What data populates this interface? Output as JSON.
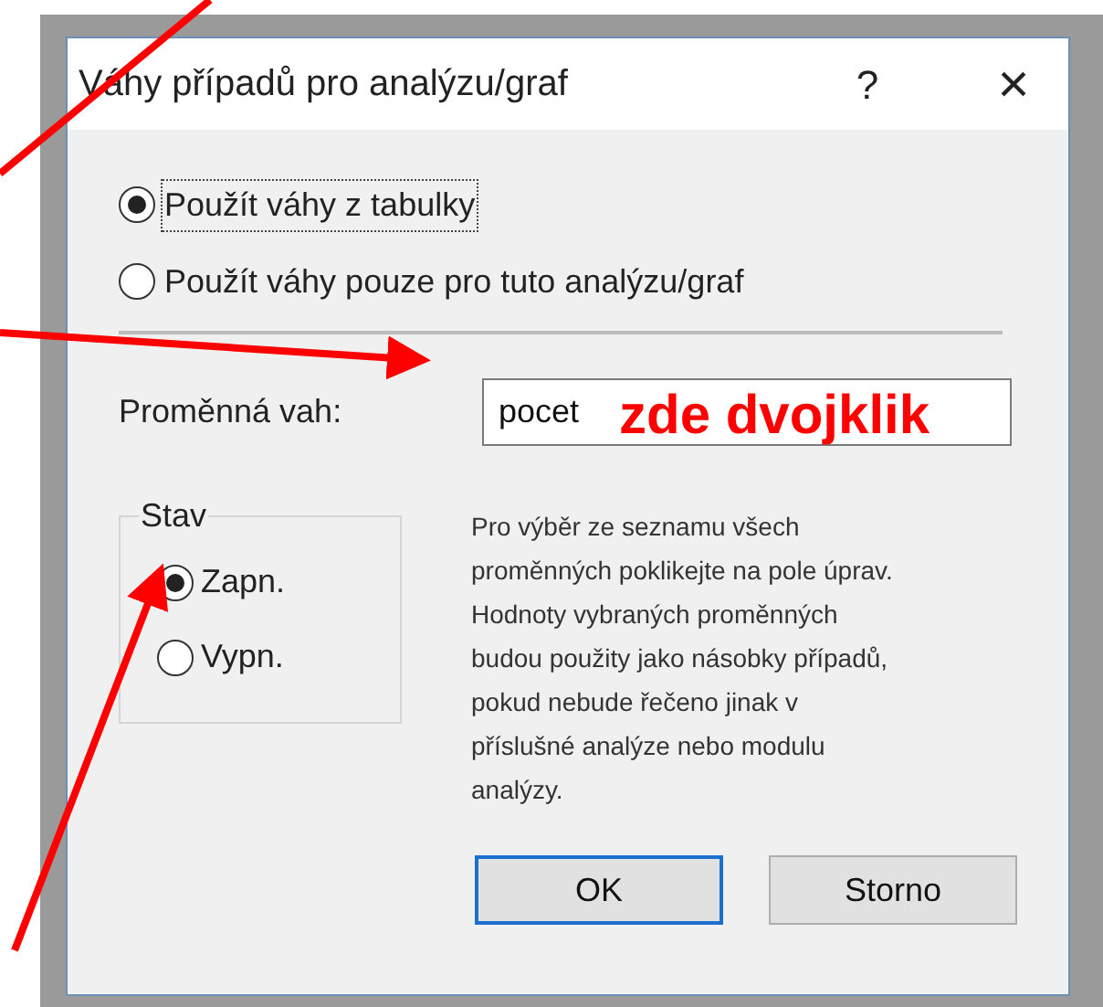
{
  "window": {
    "title": "Váhy případů pro analýzu/graf",
    "help": "?",
    "close": "×"
  },
  "source_options": [
    {
      "label": "Použít váhy z tabulky",
      "selected": true,
      "focused": true
    },
    {
      "label": "Použít váhy pouze pro tuto analýzu/graf",
      "selected": false,
      "focused": false
    }
  ],
  "weight_variable": {
    "label": "Proměnná vah:",
    "value": "pocet"
  },
  "state_group": {
    "title": "Stav",
    "options": [
      {
        "label": "Zapn.",
        "selected": true
      },
      {
        "label": "Vypn.",
        "selected": false
      }
    ]
  },
  "help_text": [
    "Pro výběr ze seznamu všech",
    "proměnných poklikejte na pole úprav.",
    "Hodnoty vybraných proměnných",
    "budou použity jako násobky případů,",
    "pokud nebude řečeno jinak v",
    "příslušné analýze nebo modulu",
    "analýzy."
  ],
  "buttons": [
    {
      "label": "OK",
      "default": true
    },
    {
      "label": "Storno",
      "default": false
    }
  ],
  "annotation": {
    "text": "zde dvojklik"
  }
}
